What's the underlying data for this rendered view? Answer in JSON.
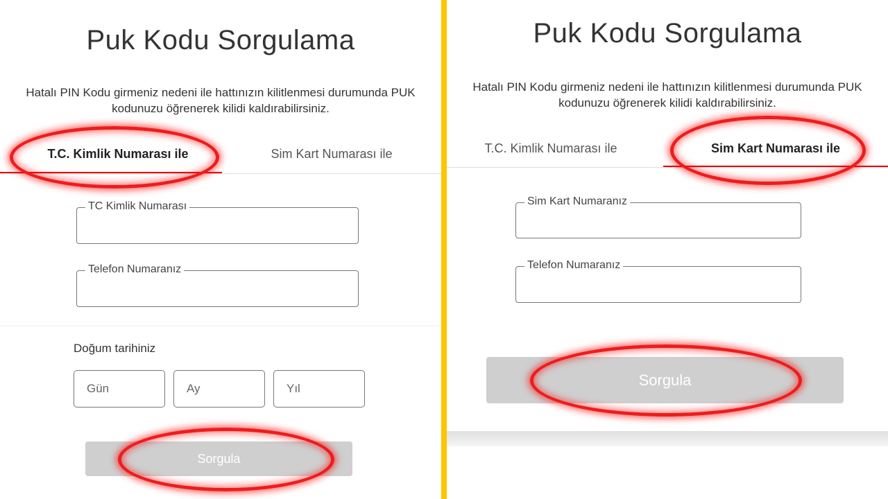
{
  "left": {
    "title": "Puk Kodu Sorgulama",
    "description_line1": "Hatalı PIN Kodu girmeniz nedeni ile hattınızın kilitlenmesi durumunda PUK",
    "description_line2": "kodunuzu öğrenerek kilidi kaldırabilirsiniz.",
    "tabs": [
      {
        "label": "T.C. Kimlik Numarası ile",
        "active": true
      },
      {
        "label": "Sim Kart Numarası ile",
        "active": false
      }
    ],
    "fields": {
      "tc_label": "TC Kimlik Numarası",
      "tc_value": "",
      "phone_label": "Telefon Numaranız",
      "phone_value": ""
    },
    "birth": {
      "label": "Doğum tarihiniz",
      "day_placeholder": "Gün",
      "month_placeholder": "Ay",
      "year_placeholder": "Yıl"
    },
    "submit_label": "Sorgula"
  },
  "right": {
    "title": "Puk Kodu Sorgulama",
    "description_line1": "Hatalı PIN Kodu girmeniz nedeni ile hattınızın kilitlenmesi durumunda PUK",
    "description_line2": "kodunuzu öğrenerek kilidi kaldırabilirsiniz.",
    "tabs": [
      {
        "label": "T.C. Kimlik Numarası ile",
        "active": false
      },
      {
        "label": "Sim Kart Numarası ile",
        "active": true
      }
    ],
    "fields": {
      "sim_label": "Sim Kart Numaranız",
      "sim_value": "",
      "phone_label": "Telefon Numaranız",
      "phone_value": ""
    },
    "submit_label": "Sorgula"
  },
  "colors": {
    "accent_red": "#e60000",
    "divider_yellow": "#ffc400",
    "button_disabled": "#cfcfcf",
    "highlight_oval": "#ee1c1c"
  }
}
